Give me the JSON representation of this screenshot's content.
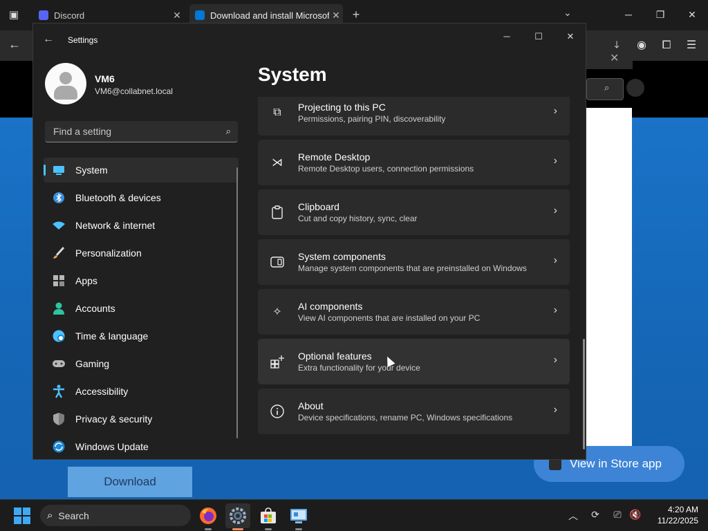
{
  "browser": {
    "tabs": [
      {
        "title": "Discord",
        "favicon_color": "#5865f2"
      },
      {
        "title": "Download and install Microsoft",
        "favicon_color": "#0078d4"
      }
    ],
    "new_tab": "+",
    "download_button": "Download",
    "store_app_button": "View in Store app"
  },
  "settings": {
    "title": "Settings",
    "user": {
      "name": "VM6",
      "email": "VM6@collabnet.local"
    },
    "search_placeholder": "Find a setting",
    "nav": [
      {
        "label": "System",
        "icon": "monitor-icon",
        "color": "#4cc2ff",
        "active": true
      },
      {
        "label": "Bluetooth & devices",
        "icon": "bluetooth-icon",
        "color": "#4cc2ff"
      },
      {
        "label": "Network & internet",
        "icon": "wifi-icon",
        "color": "#4cc2ff"
      },
      {
        "label": "Personalization",
        "icon": "brush-icon",
        "color": "#e8a25a"
      },
      {
        "label": "Apps",
        "icon": "apps-icon",
        "color": "#9aa0a6"
      },
      {
        "label": "Accounts",
        "icon": "accounts-icon",
        "color": "#2ec4a0"
      },
      {
        "label": "Time & language",
        "icon": "globe-icon",
        "color": "#4cc2ff"
      },
      {
        "label": "Gaming",
        "icon": "gamepad-icon",
        "color": "#b0b0b0"
      },
      {
        "label": "Accessibility",
        "icon": "accessibility-icon",
        "color": "#4cc2ff"
      },
      {
        "label": "Privacy & security",
        "icon": "shield-icon",
        "color": "#9aa0a6"
      },
      {
        "label": "Windows Update",
        "icon": "update-icon",
        "color": "#4cc2ff"
      }
    ],
    "page_title": "System",
    "cards": [
      {
        "title": "Projecting to this PC",
        "desc": "Permissions, pairing PIN, discoverability",
        "icon": "projecting-icon",
        "glyph": "⧉"
      },
      {
        "title": "Remote Desktop",
        "desc": "Remote Desktop users, connection permissions",
        "icon": "remote-desktop-icon",
        "glyph": "⋊"
      },
      {
        "title": "Clipboard",
        "desc": "Cut and copy history, sync, clear",
        "icon": "clipboard-icon",
        "glyph": "📋"
      },
      {
        "title": "System components",
        "desc": "Manage system components that are preinstalled on Windows",
        "icon": "system-components-icon",
        "glyph": "▭"
      },
      {
        "title": "AI components",
        "desc": "View AI components that are installed on your PC",
        "icon": "ai-components-icon",
        "glyph": "✧"
      },
      {
        "title": "Optional features",
        "desc": "Extra functionality for your device",
        "icon": "optional-features-icon",
        "glyph": "⊞"
      },
      {
        "title": "About",
        "desc": "Device specifications, rename PC, Windows specifications",
        "icon": "info-icon",
        "glyph": "ⓘ"
      }
    ]
  },
  "taskbar": {
    "search_label": "Search",
    "apps": [
      {
        "name": "firefox",
        "icon": "firefox-icon"
      },
      {
        "name": "settings",
        "icon": "settings-gear-icon",
        "active": true
      },
      {
        "name": "store",
        "icon": "store-icon"
      },
      {
        "name": "control-panel",
        "icon": "control-panel-icon"
      }
    ],
    "time": "4:20 AM",
    "date": "11/22/2025"
  }
}
